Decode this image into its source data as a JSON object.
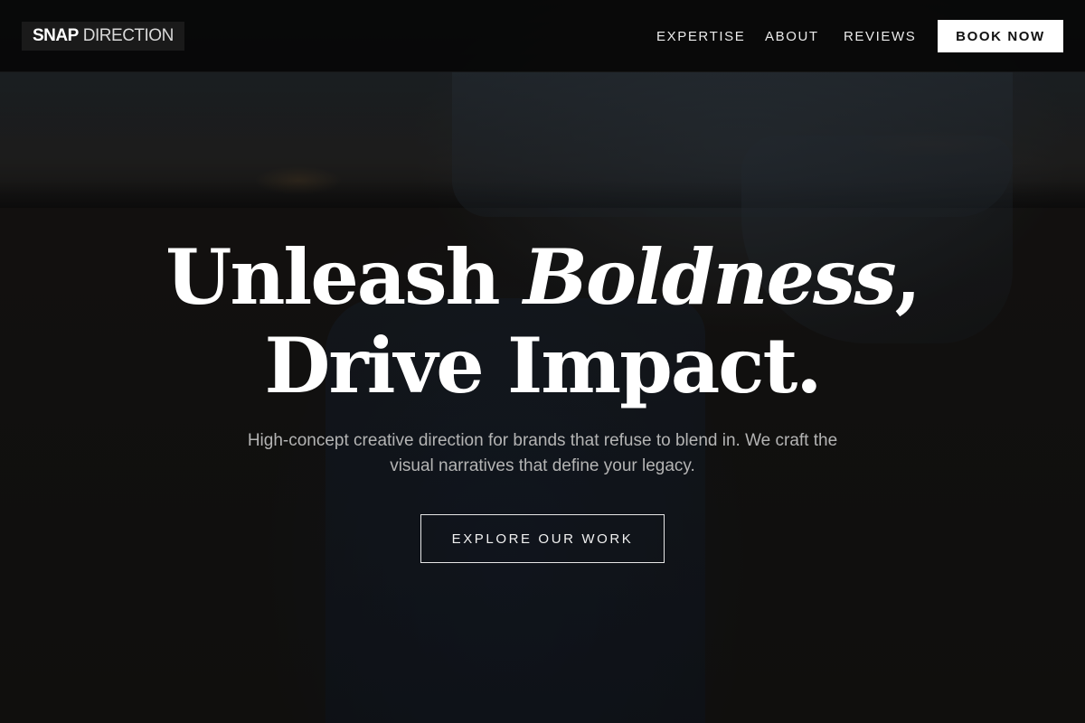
{
  "brand": {
    "strong": "SNAP",
    "light": "DIRECTION"
  },
  "nav": {
    "items": [
      {
        "label": "EXPERTISE"
      },
      {
        "label": "ABOUT"
      },
      {
        "label": "REVIEWS"
      }
    ],
    "cta_label": "BOOK NOW"
  },
  "hero": {
    "headline_part1": "Unleash",
    "headline_emphasis": "Boldness",
    "headline_comma": ",",
    "headline_line2": "Drive Impact.",
    "subtitle": "High-concept creative direction for brands that refuse to blend in. We craft the visual narratives that define your legacy.",
    "cta_label": "EXPLORE OUR WORK"
  },
  "colors": {
    "header_background": "#080808",
    "primary_button_background": "#ffffff",
    "primary_button_text": "#111111",
    "headline_text": "#ffffff",
    "subtitle_text": "#b4b4b4"
  }
}
